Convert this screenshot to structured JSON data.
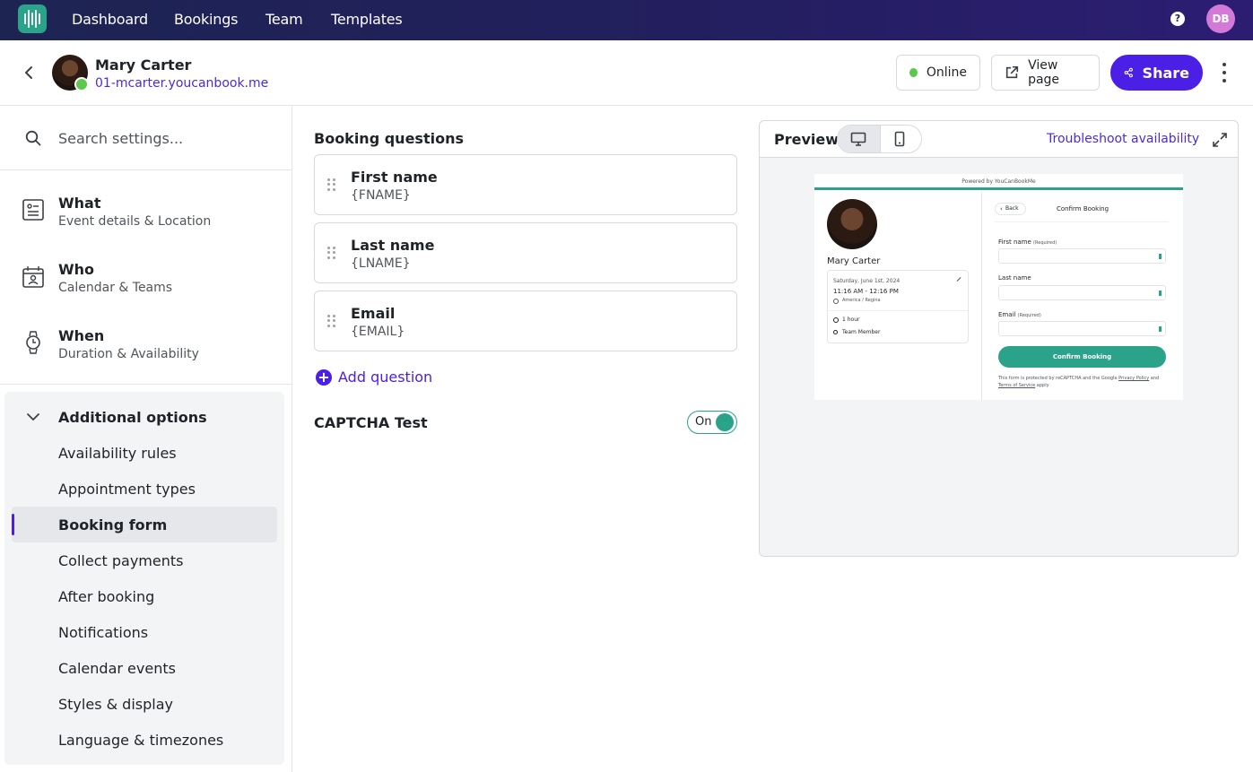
{
  "nav": {
    "links": [
      "Dashboard",
      "Bookings",
      "Team",
      "Templates"
    ],
    "help_label": "?",
    "avatar_initials": "DB"
  },
  "header": {
    "name": "Mary Carter",
    "url": "01-mcarter.youcanbook.me",
    "online_label": "Online",
    "view_page_label": "View page",
    "share_label": "Share"
  },
  "sidebar": {
    "search_placeholder": "Search settings...",
    "sections": [
      {
        "title": "What",
        "subtitle": "Event details & Location",
        "icon": "document-icon"
      },
      {
        "title": "Who",
        "subtitle": "Calendar & Teams",
        "icon": "contact-calendar-icon"
      },
      {
        "title": "When",
        "subtitle": "Duration & Availability",
        "icon": "watch-icon"
      }
    ],
    "additional_title": "Additional options",
    "menu": [
      "Availability rules",
      "Appointment types",
      "Booking form",
      "Collect payments",
      "After booking",
      "Notifications",
      "Calendar events",
      "Styles & display",
      "Language & timezones"
    ],
    "active_menu": "Booking form"
  },
  "booking": {
    "title": "Booking questions",
    "questions": [
      {
        "label": "First name",
        "token": "{FNAME}"
      },
      {
        "label": "Last name",
        "token": "{LNAME}"
      },
      {
        "label": "Email",
        "token": "{EMAIL}"
      }
    ],
    "add_question_label": "Add question",
    "captcha_label": "CAPTCHA Test",
    "captcha_toggle": "On"
  },
  "preview": {
    "title": "Preview",
    "troubleshoot_label": "Troubleshoot availability",
    "mini": {
      "powered_by": "Powered by YouCanBookMe",
      "name": "Mary Carter",
      "date": "Saturday, June 1st, 2024",
      "time": "11:16 AM - 12:16 PM",
      "timezone": "America / Regina",
      "duration": "1 hour",
      "member": "Team Member",
      "back_label": "Back",
      "confirm_title": "Confirm Booking",
      "fields": [
        {
          "label": "First name",
          "required": "(Required)"
        },
        {
          "label": "Last name",
          "required": ""
        },
        {
          "label": "Email",
          "required": "(Required)"
        }
      ],
      "confirm_button": "Confirm Booking",
      "footer_prefix": "This form is protected by reCAPTCHA and the Google",
      "privacy": "Privacy Policy",
      "and": "and",
      "terms": "Terms of Service",
      "apply": "apply"
    }
  },
  "colors": {
    "nav_bg": "#1d2452",
    "brand_purple": "#4b1fe6",
    "brand_teal": "#2aa38a",
    "online_green": "#5bc84e"
  }
}
